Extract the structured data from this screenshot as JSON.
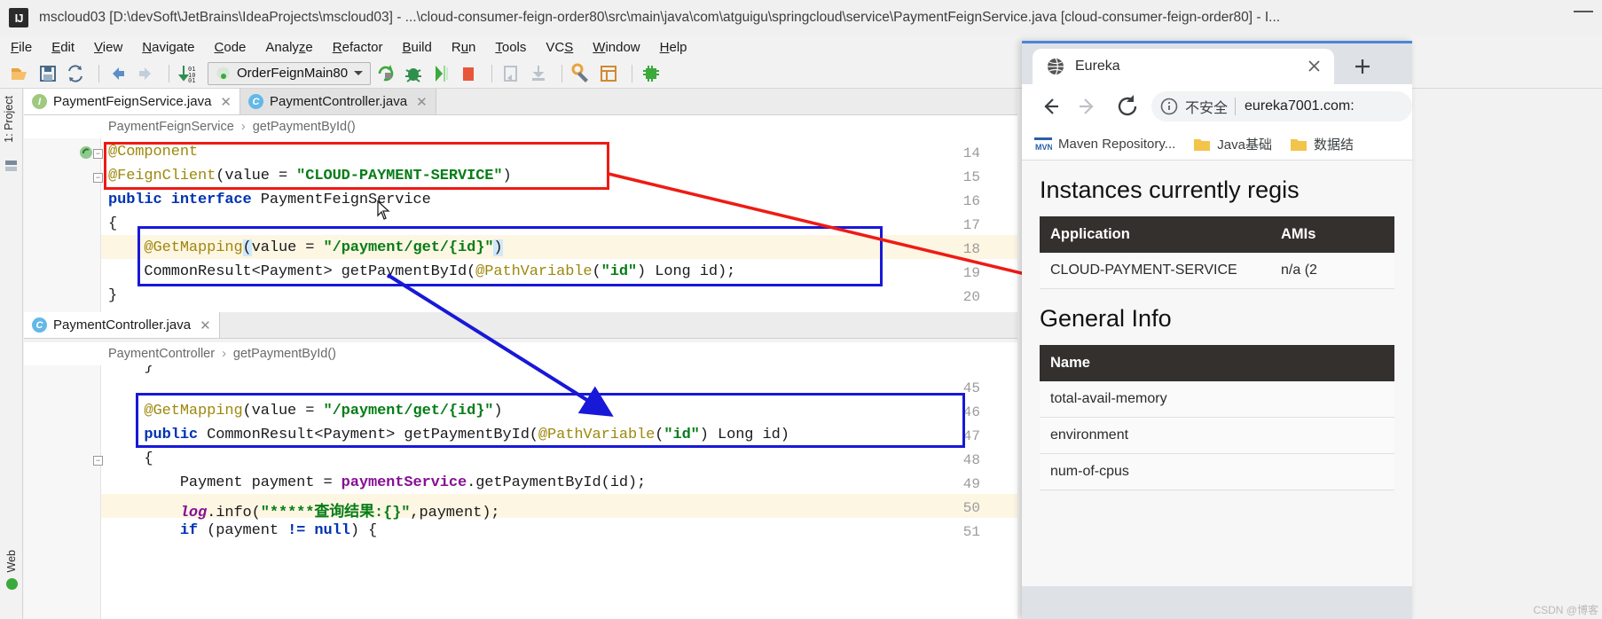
{
  "ide": {
    "title": "mscloud03 [D:\\devSoft\\JetBrains\\IdeaProjects\\mscloud03] - ...\\cloud-consumer-feign-order80\\src\\main\\java\\com\\atguigu\\springcloud\\service\\PaymentFeignService.java [cloud-consumer-feign-order80] - I...",
    "logo_text": "IJ",
    "menu": [
      "File",
      "Edit",
      "View",
      "Navigate",
      "Code",
      "Analyze",
      "Refactor",
      "Build",
      "Run",
      "Tools",
      "VCS",
      "Window",
      "Help"
    ],
    "toolbar": {
      "run_config": "OrderFeignMain80",
      "icons": [
        "open-folder-icon",
        "save-all-icon",
        "sync-icon",
        "back-icon",
        "forward-icon",
        "sort-icon",
        "run-icon",
        "debug-icon",
        "run-coverage-icon",
        "stop-icon",
        "step-over-icon",
        "step-into-icon",
        "settings-icon",
        "project-structure-icon",
        "plugins-icon"
      ]
    },
    "left_strip": {
      "project_label": "1: Project",
      "web_label": "Web"
    },
    "editor_top": {
      "tabs": [
        {
          "label": "PaymentFeignService.java",
          "kind": "interface",
          "active": true
        },
        {
          "label": "PaymentController.java",
          "kind": "class",
          "active": false
        }
      ],
      "breadcrumb": {
        "class": "PaymentFeignService",
        "member": "getPaymentById()"
      },
      "lines": [
        {
          "n": "14",
          "text": "@Component"
        },
        {
          "n": "15",
          "text": "@FeignClient(value = \"CLOUD-PAYMENT-SERVICE\")"
        },
        {
          "n": "16",
          "text": "public interface PaymentFeignService"
        },
        {
          "n": "17",
          "text": "{"
        },
        {
          "n": "18",
          "text": "    @GetMapping(value = \"/payment/get/{id}\")"
        },
        {
          "n": "19",
          "text": "    CommonResult<Payment> getPaymentById(@PathVariable(\"id\") Long id);"
        },
        {
          "n": "20",
          "text": "}"
        }
      ]
    },
    "editor_bottom": {
      "tabs": [
        {
          "label": "PaymentController.java",
          "kind": "class",
          "active": true
        }
      ],
      "breadcrumb": {
        "class": "PaymentController",
        "member": "getPaymentById()"
      },
      "lines": [
        {
          "n": "45",
          "text": ""
        },
        {
          "n": "46",
          "text": "    @GetMapping(value = \"/payment/get/{id}\")"
        },
        {
          "n": "47",
          "text": "    public CommonResult<Payment> getPaymentById(@PathVariable(\"id\") Long id)"
        },
        {
          "n": "48",
          "text": "    {"
        },
        {
          "n": "49",
          "text": "        Payment payment = paymentService.getPaymentById(id);"
        },
        {
          "n": "50",
          "text": "        log.info(\"*****查询结果:{}\",payment);"
        },
        {
          "n": "51",
          "text": "        if (payment != null) {"
        }
      ]
    },
    "annotations": {
      "red_box_label": "feign-client-annotation-highlight",
      "blue_box_label": "get-mapping-signature-highlight",
      "red_arrow_label": "service-name-to-eureka-arrow",
      "blue_arrow_label": "feign-to-controller-mapping-arrow"
    }
  },
  "browser": {
    "tab": {
      "title": "Eureka",
      "favicon": "globe-icon"
    },
    "new_tab_label": "+",
    "nav": {
      "back": "back-icon",
      "forward": "forward-icon",
      "reload": "reload-icon"
    },
    "omnibox": {
      "security_label": "不安全",
      "url": "eureka7001.com:"
    },
    "bookmarks": [
      {
        "label": "Maven Repository...",
        "icon": "maven-icon"
      },
      {
        "label": "Java基础",
        "icon": "folder-icon"
      },
      {
        "label": "数据结",
        "icon": "folder-icon"
      }
    ],
    "page": {
      "instances_heading": "Instances currently regis",
      "instances_table": {
        "headers": [
          "Application",
          "AMIs"
        ],
        "rows": [
          [
            "CLOUD-PAYMENT-SERVICE",
            "n/a (2"
          ]
        ]
      },
      "general_heading": "General Info",
      "general_table": {
        "headers": [
          "Name"
        ],
        "rows": [
          [
            "total-avail-memory"
          ],
          [
            "environment"
          ],
          [
            "num-of-cpus"
          ]
        ]
      }
    }
  },
  "watermark": "CSDN @博客"
}
